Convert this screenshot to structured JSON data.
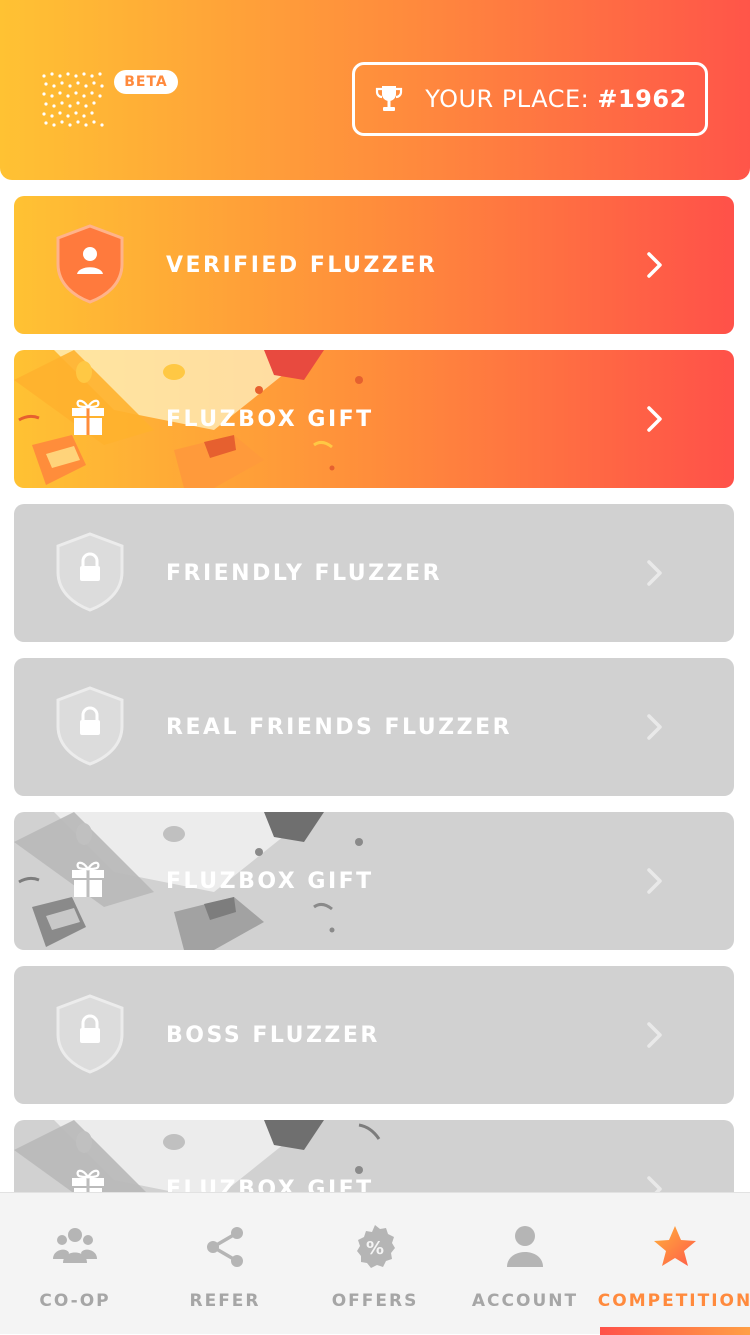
{
  "header": {
    "beta_label": "BETA",
    "place_prefix": "YOUR PLACE: ",
    "place_value": "#1962",
    "trophy_icon": "trophy-icon"
  },
  "achievements": [
    {
      "label": "VERIFIED FLUZZER",
      "state": "unlocked",
      "icon": "verified-shield-icon"
    },
    {
      "label": "FLUZBOX GIFT",
      "state": "unlocked",
      "icon": "gift-icon"
    },
    {
      "label": "FRIENDLY FLUZZER",
      "state": "locked",
      "icon": "lock-shield-icon"
    },
    {
      "label": "REAL FRIENDS FLUZZER",
      "state": "locked",
      "icon": "lock-shield-icon"
    },
    {
      "label": "FLUZBOX GIFT",
      "state": "locked",
      "icon": "gift-icon"
    },
    {
      "label": "BOSS FLUZZER",
      "state": "locked",
      "icon": "lock-shield-icon"
    },
    {
      "label": "FLUZBOX GIFT",
      "state": "locked",
      "icon": "gift-icon"
    }
  ],
  "tabbar": {
    "tabs": [
      {
        "label": "CO-OP",
        "icon": "group-icon"
      },
      {
        "label": "REFER",
        "icon": "share-icon"
      },
      {
        "label": "OFFERS",
        "icon": "percent-badge-icon"
      },
      {
        "label": "ACCOUNT",
        "icon": "user-icon"
      },
      {
        "label": "COMPETITION",
        "icon": "star-icon"
      }
    ],
    "active": "COMPETITION"
  },
  "colors": {
    "gradient_start": "#ffc233",
    "gradient_end": "#ff5149",
    "locked_card": "#d1d1d1",
    "tab_inactive": "#a6a6a6",
    "tab_active": "#ff8a3d"
  }
}
